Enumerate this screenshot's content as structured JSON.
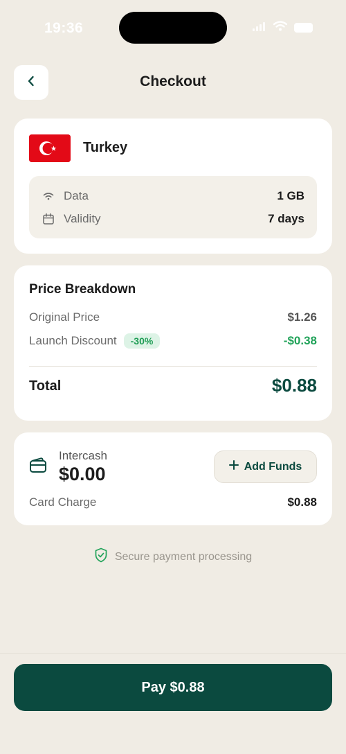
{
  "status_bar": {
    "time": "19:36"
  },
  "header": {
    "title": "Checkout"
  },
  "plan": {
    "country": "Turkey",
    "flag_colors": {
      "red": "#e30a17",
      "white": "#ffffff"
    },
    "specs": [
      {
        "icon": "wifi-icon",
        "label": "Data",
        "value": "1 GB"
      },
      {
        "icon": "calendar-icon",
        "label": "Validity",
        "value": "7 days"
      }
    ]
  },
  "price": {
    "title": "Price Breakdown",
    "original_label": "Original Price",
    "original_value": "$1.26",
    "discount_label": "Launch Discount",
    "discount_badge": "-30%",
    "discount_value": "-$0.38",
    "total_label": "Total",
    "total_value": "$0.88"
  },
  "wallet": {
    "icon": "wallet-icon",
    "name": "Intercash",
    "balance": "$0.00",
    "add_funds_label": "Add Funds",
    "charge_label": "Card Charge",
    "charge_value": "$0.88"
  },
  "secure": {
    "icon": "shield-check-icon",
    "text": "Secure payment processing"
  },
  "pay_button": {
    "label": "Pay $0.88"
  },
  "colors": {
    "background": "#f0ece4",
    "accent": "#0b4a3f",
    "discount_green": "#22a35a",
    "badge_bg": "#ddf3e6"
  }
}
